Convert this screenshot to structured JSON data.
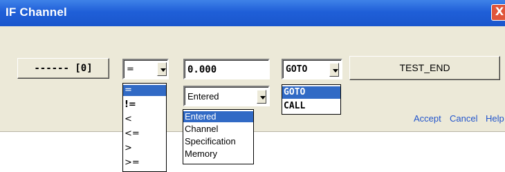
{
  "window": {
    "title": "IF Channel",
    "close_glyph": "X"
  },
  "channel_button": {
    "label": "------ [0]"
  },
  "operator": {
    "selected": "=",
    "options": [
      "=",
      "!=",
      "<",
      "<=",
      ">",
      ">="
    ]
  },
  "value_input": {
    "value": "0.000"
  },
  "source": {
    "selected": "Entered",
    "options": [
      "Entered",
      "Channel",
      "Specification",
      "Memory"
    ]
  },
  "action": {
    "selected": "GOTO",
    "options": [
      "GOTO",
      "CALL"
    ]
  },
  "target_button": {
    "label": "TEST_END"
  },
  "links": {
    "accept": "Accept",
    "cancel": "Cancel",
    "help": "Help"
  },
  "colors": {
    "title_bar": "#1f5fd8",
    "dialog_bg": "#ece9d8",
    "selection": "#316ac5",
    "link": "#2255cc",
    "close_button": "#e0553b"
  }
}
